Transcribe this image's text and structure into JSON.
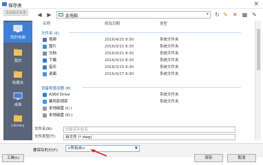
{
  "window": {
    "title": "保存类",
    "close_glyph": "×"
  },
  "toolbar": {
    "back_glyph": "◀",
    "forward_glyph": "▶",
    "path": "此电脑",
    "refresh_glyph": "↻",
    "search_glyph": "✎",
    "view_glyph": "▦",
    "tools_glyph": "✎"
  },
  "sidebar": {
    "badge": "添加最近目录",
    "items": [
      {
        "label": "我的电脑",
        "icon": "computer-icon"
      },
      {
        "label": "我的",
        "icon": "folder-icon"
      },
      {
        "label": "收藏夹",
        "icon": "folder-icon"
      },
      {
        "label": "桌面",
        "icon": "monitor-icon"
      },
      {
        "label": "Library",
        "icon": "folder-icon"
      }
    ]
  },
  "columns": {
    "name": "名称",
    "date": "修改日期",
    "type": "类型"
  },
  "groups": {
    "folders": "文件夹 (6)",
    "devices": "设备和驱动器 (8)"
  },
  "folders": [
    {
      "name": "视频",
      "date": "2016/4/25 8:30",
      "type": "系统文件夹",
      "color": "#5b6fa8"
    },
    {
      "name": "图片",
      "date": "2016/3/15 8:30",
      "type": "系统文件夹",
      "color": "#3d8fd4"
    },
    {
      "name": "文档",
      "date": "2016/4/21 8:30",
      "type": "系统文件夹",
      "color": "#7a8da8"
    },
    {
      "name": "下载",
      "date": "2016/4/10 8:30",
      "type": "系统文件夹",
      "color": "#2f7bd0"
    },
    {
      "name": "音乐",
      "date": "2016/3/15 8:30",
      "type": "系统文件夹",
      "color": "#3a7bc8"
    },
    {
      "name": "桌面",
      "date": "2016/4/27 8:30",
      "type": "系统文件夹",
      "color": "#4a90d9"
    }
  ],
  "devices": [
    {
      "name": "A360 Drive",
      "type": "系统文件夹",
      "color": "#2c86d1"
    },
    {
      "name": "暴风影视库",
      "type": "系统文件夹",
      "color": "#3b9be0"
    },
    {
      "name": "本地磁盘 (C:)",
      "type": "",
      "color": "#8e99a8"
    },
    {
      "name": "本地磁盘 (D:)",
      "type": "",
      "color": "#8e99a8"
    }
  ],
  "fields": {
    "filename_label": "文件名(N):",
    "filename_placeholder": "白最名利吉名",
    "filetype_label": "文件类型(T):",
    "filetype_value": "自文件 (*.dwg)"
  },
  "category": {
    "label": "要保存的分(F):",
    "value": "<所有自>",
    "dd_glyph": "▼"
  },
  "buttons": {
    "tools": "工具(L)",
    "save": "保存",
    "cancel": "取消"
  },
  "accent": "#3f7fd6",
  "arrow_color": "#d62020"
}
